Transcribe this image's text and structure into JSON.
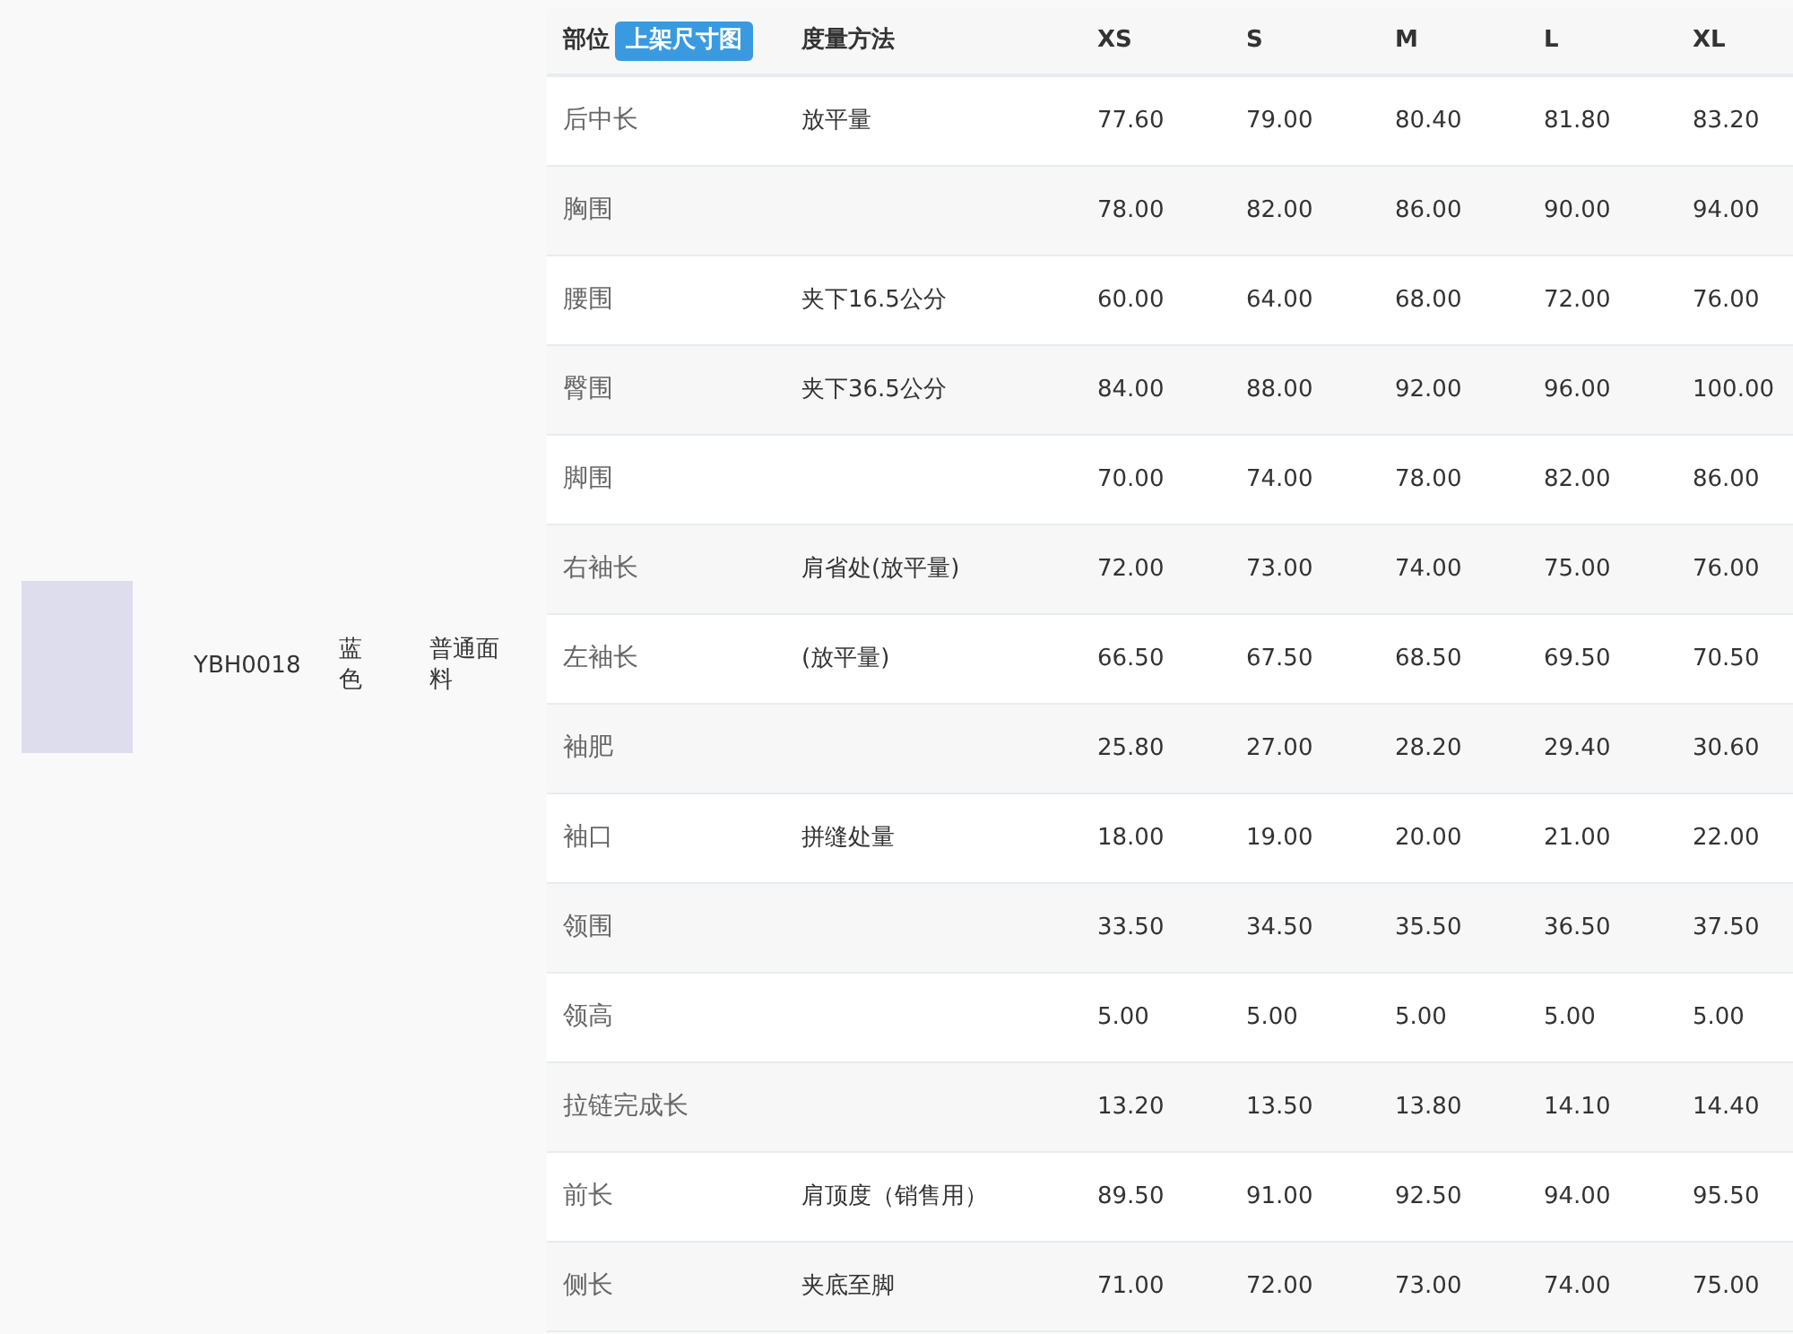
{
  "product": {
    "code": "YBH0018",
    "color_name": "蓝色",
    "fabric": "普通面料"
  },
  "size_table": {
    "part_header": "部位",
    "size_chart_button": "上架尺寸图",
    "method_header": "度量方法",
    "sizes": [
      "XS",
      "S",
      "M",
      "L",
      "XL"
    ],
    "rows": [
      {
        "part": "后中长",
        "method": "放平量",
        "values": [
          "77.60",
          "79.00",
          "80.40",
          "81.80",
          "83.20"
        ]
      },
      {
        "part": "胸围",
        "method": "",
        "values": [
          "78.00",
          "82.00",
          "86.00",
          "90.00",
          "94.00"
        ]
      },
      {
        "part": "腰围",
        "method": "夹下16.5公分",
        "values": [
          "60.00",
          "64.00",
          "68.00",
          "72.00",
          "76.00"
        ]
      },
      {
        "part": "臀围",
        "method": "夹下36.5公分",
        "values": [
          "84.00",
          "88.00",
          "92.00",
          "96.00",
          "100.00"
        ]
      },
      {
        "part": "脚围",
        "method": "",
        "values": [
          "70.00",
          "74.00",
          "78.00",
          "82.00",
          "86.00"
        ]
      },
      {
        "part": "右袖长",
        "method": "肩省处(放平量)",
        "values": [
          "72.00",
          "73.00",
          "74.00",
          "75.00",
          "76.00"
        ]
      },
      {
        "part": "左袖长",
        "method": "(放平量)",
        "values": [
          "66.50",
          "67.50",
          "68.50",
          "69.50",
          "70.50"
        ]
      },
      {
        "part": "袖肥",
        "method": "",
        "values": [
          "25.80",
          "27.00",
          "28.20",
          "29.40",
          "30.60"
        ]
      },
      {
        "part": "袖口",
        "method": "拼缝处量",
        "values": [
          "18.00",
          "19.00",
          "20.00",
          "21.00",
          "22.00"
        ]
      },
      {
        "part": "领围",
        "method": "",
        "values": [
          "33.50",
          "34.50",
          "35.50",
          "36.50",
          "37.50"
        ]
      },
      {
        "part": "领高",
        "method": "",
        "values": [
          "5.00",
          "5.00",
          "5.00",
          "5.00",
          "5.00"
        ]
      },
      {
        "part": "拉链完成长",
        "method": "",
        "values": [
          "13.20",
          "13.50",
          "13.80",
          "14.10",
          "14.40"
        ]
      },
      {
        "part": "前长",
        "method": "肩顶度（销售用）",
        "values": [
          "89.50",
          "91.00",
          "92.50",
          "94.00",
          "95.50"
        ]
      },
      {
        "part": "侧长",
        "method": "夹底至脚",
        "values": [
          "71.00",
          "72.00",
          "73.00",
          "74.00",
          "75.00"
        ]
      }
    ]
  }
}
